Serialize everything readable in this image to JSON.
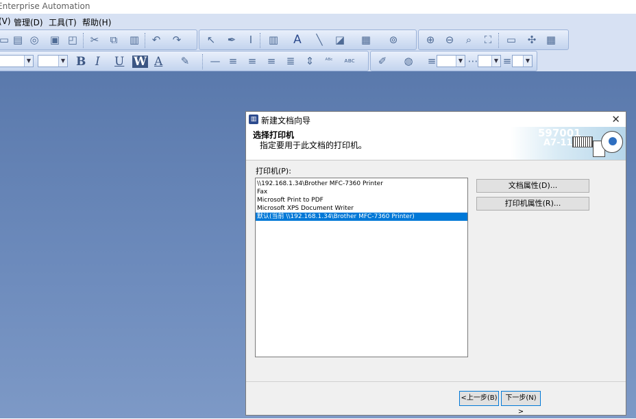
{
  "app": {
    "title": "Enterprise Automation"
  },
  "menu": [
    "(V)",
    "管理(D)",
    "工具(T)",
    "帮助(H)"
  ],
  "toolbar": {
    "format": {
      "bold": "B",
      "italic": "I",
      "underline": "U",
      "word": "W",
      "text_a": "A"
    }
  },
  "dialog": {
    "title": "新建文档向导",
    "close": "✕",
    "header_title": "选择打印机",
    "header_subtitle": "指定要用于此文档的打印机。",
    "header_art": {
      "num1": "597001",
      "num2": "A7-118"
    },
    "printer_label": "打印机(P):",
    "printers": [
      "\\\\192.168.1.34\\Brother MFC-7360 Printer",
      "Fax",
      "Microsoft Print to PDF",
      "Microsoft XPS Document Writer",
      "默认(当前 \\\\192.168.1.34\\Brother MFC-7360 Printer)"
    ],
    "selected_index": 4,
    "doc_props_button": "文档属性(D)...",
    "printer_props_button": "打印机属性(R)...",
    "back_button": "<上一步(B)",
    "next_button": "下一步(N) >"
  }
}
